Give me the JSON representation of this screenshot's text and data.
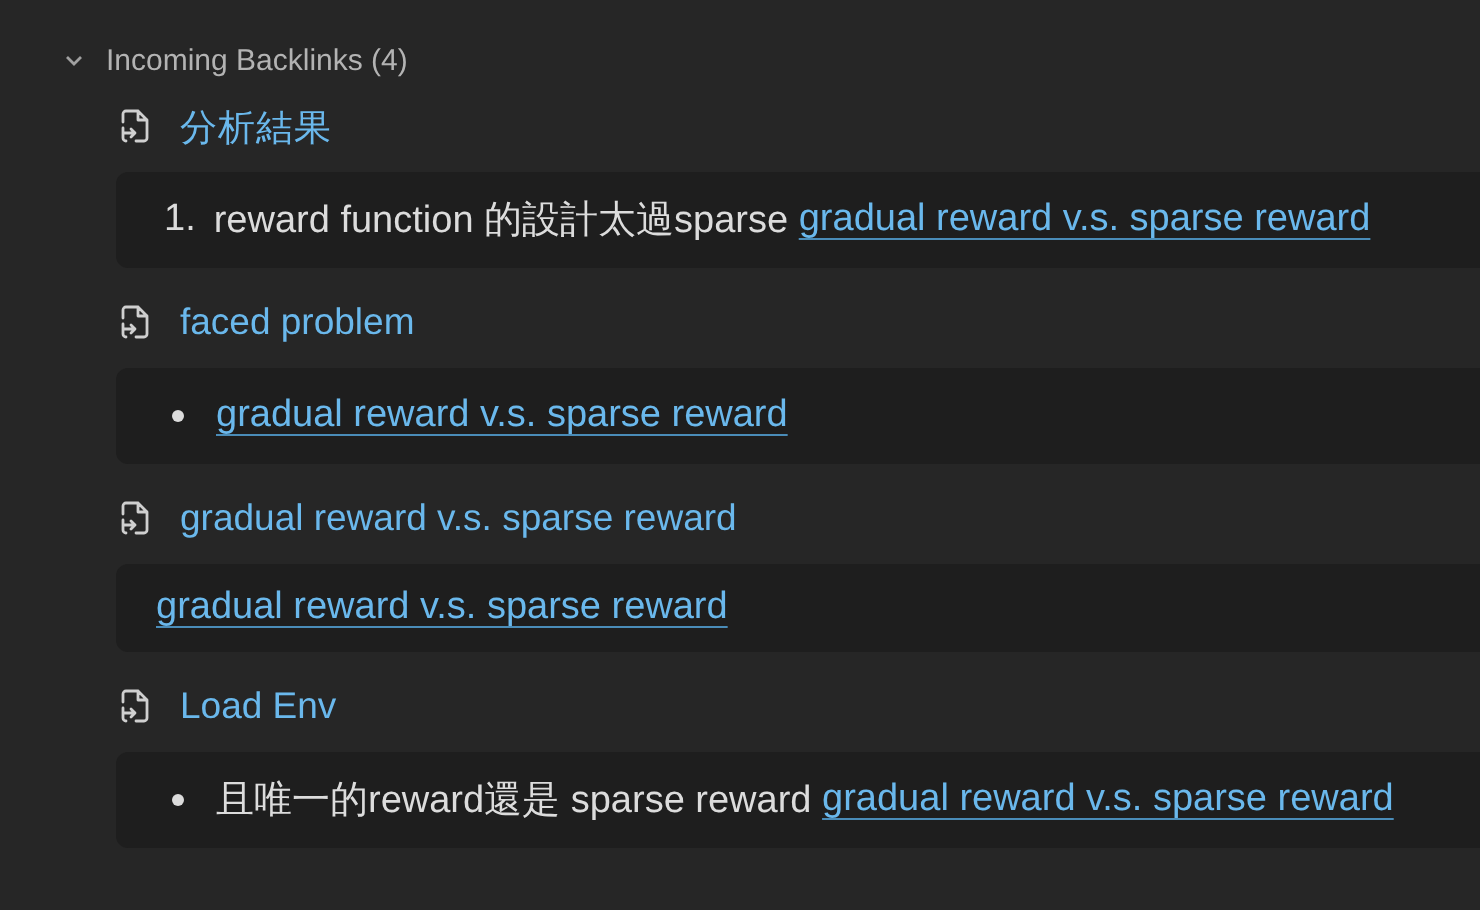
{
  "backlinks": {
    "title": "Incoming Backlinks (4)",
    "expanded": true,
    "files": [
      {
        "title": "分析結果",
        "snippet": {
          "kind": "numbered",
          "number": "1.",
          "segments": [
            {
              "text": "reward function 的設計太過sparse ",
              "link": false
            },
            {
              "text": "gradual reward v.s. sparse reward",
              "link": true
            }
          ]
        }
      },
      {
        "title": "faced problem",
        "snippet": {
          "kind": "bullet",
          "segments": [
            {
              "text": "gradual reward v.s. sparse reward",
              "link": true
            }
          ]
        }
      },
      {
        "title": "gradual reward v.s. sparse reward",
        "snippet": {
          "kind": "plain",
          "segments": [
            {
              "text": "gradual reward v.s. sparse reward",
              "link": true
            }
          ]
        }
      },
      {
        "title": "Load Env",
        "snippet": {
          "kind": "bullet",
          "segments": [
            {
              "text": "且唯一的reward還是 sparse reward ",
              "link": false
            },
            {
              "text": "gradual reward v.s. sparse reward",
              "link": true
            }
          ]
        }
      }
    ]
  }
}
